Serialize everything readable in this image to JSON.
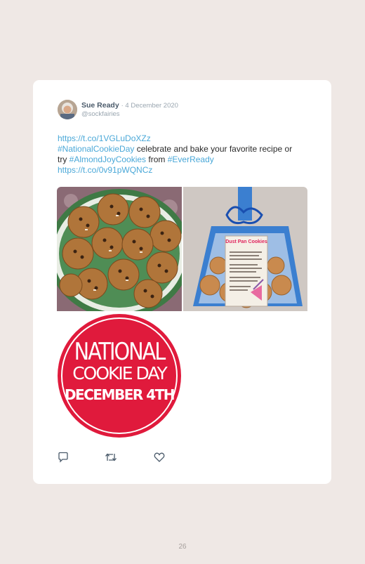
{
  "tweet": {
    "author_name": "Sue Ready",
    "date": "· 4 December 2020",
    "handle": "@sockfairies",
    "link1": "https://t.co/1VGLuDoXZz",
    "hashtag_national": "#NationalCookieDay",
    "text_part1": " celebrate and bake your favorite recipe or try ",
    "hashtag_almond": "#AlmondJoyCookies",
    "text_part2": " from ",
    "hashtag_ever": "#EverReady",
    "link2": "https://t.co/0v91pWQNCz"
  },
  "media": {
    "dustpan_label_title": "Dust Pan Cookies",
    "badge_line1": "NATIONAL",
    "badge_line2": "COOKIE DAY",
    "badge_line3": "DECEMBER 4TH"
  },
  "actions": {
    "reply_icon": "reply-icon",
    "retweet_icon": "retweet-icon",
    "like_icon": "heart-icon"
  },
  "colors": {
    "page_bg": "#efe8e5",
    "link": "#4aa8d8",
    "badge_red": "#e01a3c"
  },
  "page_number": "26"
}
